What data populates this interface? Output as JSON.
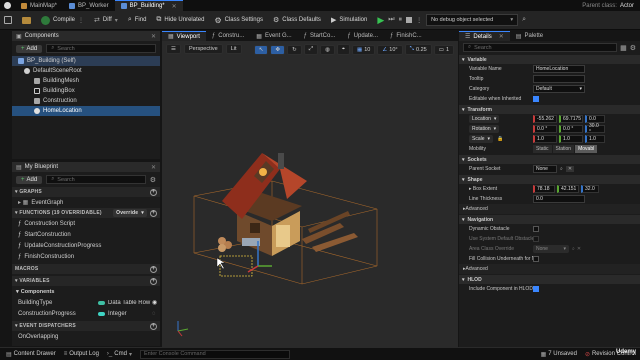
{
  "tabs": [
    {
      "label": "MainMap*"
    },
    {
      "label": "BP_Worker"
    },
    {
      "label": "BP_Building*"
    }
  ],
  "parent_class": "Parent class:",
  "parent_class_value": "Actor",
  "toolbar": {
    "compile": "Compile",
    "diff": "Diff",
    "find": "Find",
    "hide_unrelated": "Hide Unrelated",
    "class_settings": "Class Settings",
    "class_defaults": "Class Defaults",
    "simulation": "Simulation",
    "debug_select": "No debug object selected"
  },
  "components": {
    "title": "Components",
    "add": "Add",
    "search_placeholder": "Search",
    "tree": [
      {
        "label": "BP_Building (Self)"
      },
      {
        "label": "DefaultSceneRoot"
      },
      {
        "label": "BuildingMesh"
      },
      {
        "label": "BuildingBox"
      },
      {
        "label": "Construction"
      },
      {
        "label": "HomeLocation"
      }
    ]
  },
  "my_blueprint": {
    "title": "My Blueprint",
    "add": "Add",
    "search_placeholder": "Search",
    "graphs_header": "GRAPHS",
    "graphs": [
      "EventGraph"
    ],
    "functions_header": "FUNCTIONS (19 OVERRIDABLE)",
    "override": "Override",
    "functions": [
      "Construction Script",
      "StartConstruction",
      "UpdateConstructionProgress",
      "FinishConstruction"
    ],
    "macros_header": "MACROS",
    "variables_header": "VARIABLES",
    "components_label": "Components",
    "variables": [
      {
        "name": "BuildingType",
        "type": "Data Table Row"
      },
      {
        "name": "ConstructionProgress",
        "type": "Integer"
      }
    ],
    "dispatchers_header": "EVENT DISPATCHERS",
    "dispatchers": [
      "OnOverlapping"
    ]
  },
  "viewport_tabs": [
    "Viewport",
    "Constru...",
    "Event G...",
    "StartCo...",
    "Update...",
    "FinishC..."
  ],
  "viewport": {
    "perspective": "Perspective",
    "lit": "Lit",
    "grid_snap": "10",
    "rot_snap": "10°",
    "scale_snap": "0.25",
    "cam_speed": "1"
  },
  "details": {
    "tab": "Details",
    "palette_tab": "Palette",
    "search_placeholder": "Search",
    "variable_header": "Variable",
    "variable_name_label": "Variable Name",
    "variable_name": "HomeLocation",
    "tooltip_label": "Tooltip",
    "category_label": "Category",
    "category": "Default",
    "editable_label": "Editable when Inherited",
    "transform_header": "Transform",
    "location_label": "Location",
    "location": [
      "-55.262",
      "69.7175",
      "0.0"
    ],
    "rotation_label": "Rotation",
    "rotation": [
      "0.0 °",
      "0.0 °",
      "30.0 °"
    ],
    "scale_label": "Scale",
    "scale": [
      "1.0",
      "1.0",
      "1.0"
    ],
    "mobility_label": "Mobility",
    "mobility": [
      "Static",
      "Station",
      "Movabl"
    ],
    "sockets_header": "Sockets",
    "parent_socket_label": "Parent Socket",
    "parent_socket": "None",
    "shape_header": "Shape",
    "box_extent_label": "Box Extent",
    "box_extent": [
      "78.18",
      "42.151",
      "32.0"
    ],
    "line_thickness_label": "Line Thickness",
    "line_thickness": "0.0",
    "advanced1": "Advanced",
    "navigation_header": "Navigation",
    "dynamic_obstacle_label": "Dynamic Obstacle",
    "use_default_label": "Use System Default Obstacle ...",
    "area_class_label": "Area Class Override",
    "area_class": "None",
    "fill_collision_label": "Fill Collision Underneath for N...",
    "advanced2": "Advanced",
    "hlod_header": "HLOD",
    "include_hlod_label": "Include Component in HLOD"
  },
  "statusbar": {
    "content_drawer": "Content Drawer",
    "output_log": "Output Log",
    "cmd": "Cmd",
    "console_placeholder": "Enter Console Command",
    "unsaved": "7 Unsaved",
    "revision": "Revision Control"
  },
  "watermark": "Udemy",
  "colors": {
    "accent": "#3a86ff",
    "selection": "#26517f",
    "play_green": "#37c252"
  }
}
